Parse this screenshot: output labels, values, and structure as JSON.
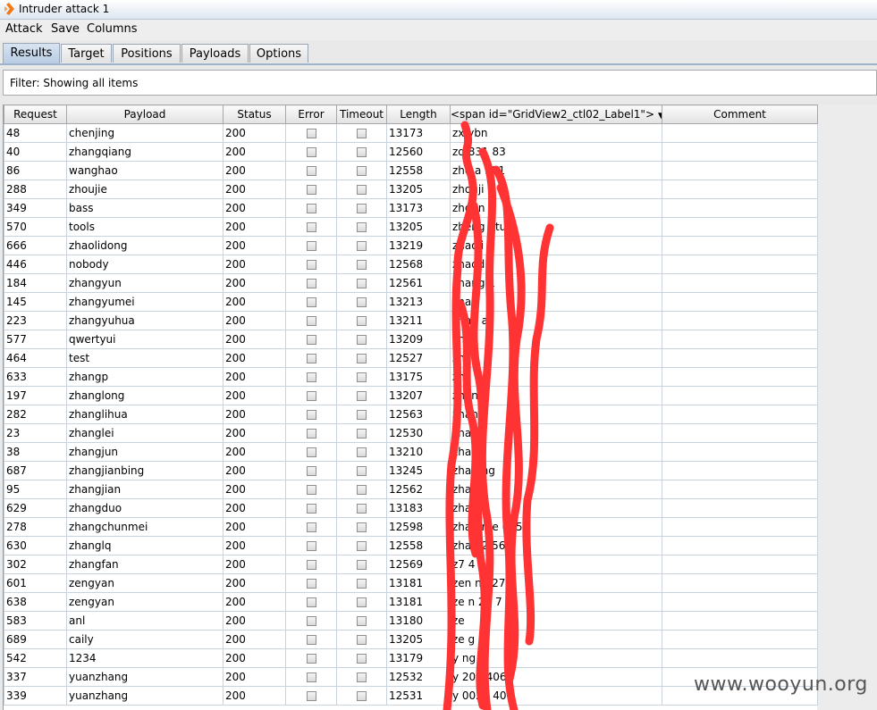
{
  "window": {
    "title": "Intruder attack 1"
  },
  "menu": [
    "Attack",
    "Save",
    "Columns"
  ],
  "tabs": [
    "Results",
    "Target",
    "Positions",
    "Payloads",
    "Options"
  ],
  "active_tab": "Results",
  "filter": {
    "text": "Filter: Showing all items"
  },
  "table": {
    "columns": [
      "Request",
      "Payload",
      "Status",
      "Error",
      "Timeout",
      "Length",
      "<span id=\"GridView2_ctl02_Label1\">",
      "Comment"
    ],
    "rows": [
      {
        "request": "48",
        "payload": "chenjing",
        "status": "200",
        "length": "13173",
        "label": "zx  ybn"
      },
      {
        "request": "40",
        "payload": "zhangqiang",
        "status": "200",
        "length": "12560",
        "label": "zq   831  83"
      },
      {
        "request": "86",
        "payload": "wanghao",
        "status": "200",
        "length": "12558",
        "label": "zho   a    321"
      },
      {
        "request": "288",
        "payload": "zhoujie",
        "status": "200",
        "length": "13205",
        "label": "zhouji"
      },
      {
        "request": "349",
        "payload": "bass",
        "status": "200",
        "length": "13173",
        "label": "zhdon"
      },
      {
        "request": "570",
        "payload": "tools",
        "status": "200",
        "length": "13205",
        "label": "zheng      gtun"
      },
      {
        "request": "666",
        "payload": "zhaolidong",
        "status": "200",
        "length": "13219",
        "label": "zhaoli     g"
      },
      {
        "request": "446",
        "payload": "nobody",
        "status": "200",
        "length": "12568",
        "label": "zhaod"
      },
      {
        "request": "184",
        "payload": "zhangyun",
        "status": "200",
        "length": "12561",
        "label": "zhang     1"
      },
      {
        "request": "145",
        "payload": "zhangyumei",
        "status": "200",
        "length": "13213",
        "label": "zhan"
      },
      {
        "request": "223",
        "payload": "zhangyuhua",
        "status": "200",
        "length": "13211",
        "label": "zhan       a"
      },
      {
        "request": "577",
        "payload": "qwertyui",
        "status": "200",
        "length": "13209",
        "label": "zha"
      },
      {
        "request": "464",
        "payload": "test",
        "status": "200",
        "length": "12527",
        "label": "zhan"
      },
      {
        "request": "633",
        "payload": "zhangp",
        "status": "200",
        "length": "13175",
        "label": "zh"
      },
      {
        "request": "197",
        "payload": "zhanglong",
        "status": "200",
        "length": "13207",
        "label": "zhan"
      },
      {
        "request": "282",
        "payload": "zhanglihua",
        "status": "200",
        "length": "12563",
        "label": "zhan       a"
      },
      {
        "request": "23",
        "payload": "zhanglei",
        "status": "200",
        "length": "12530",
        "label": "zhan"
      },
      {
        "request": "38",
        "payload": "zhangjun",
        "status": "200",
        "length": "13210",
        "label": "zhan"
      },
      {
        "request": "687",
        "payload": "zhangjianbing",
        "status": "200",
        "length": "13245",
        "label": "zhan        ng"
      },
      {
        "request": "95",
        "payload": "zhangjian",
        "status": "200",
        "length": "12562",
        "label": "zhan"
      },
      {
        "request": "629",
        "payload": "zhangduo",
        "status": "200",
        "length": "13183",
        "label": "zhan"
      },
      {
        "request": "278",
        "payload": "zhangchunmei",
        "status": "200",
        "length": "12598",
        "label": "zhan       me  005"
      },
      {
        "request": "630",
        "payload": "zhanglq",
        "status": "200",
        "length": "12558",
        "label": "zhan    2  56"
      },
      {
        "request": "302",
        "payload": "zhangfan",
        "status": "200",
        "length": "12569",
        "label": "z7     4"
      },
      {
        "request": "601",
        "payload": "zengyan",
        "status": "200",
        "length": "13181",
        "label": "zen     n4   27  7"
      },
      {
        "request": "638",
        "payload": "zengyan",
        "status": "200",
        "length": "13181",
        "label": "ze       n    27  7"
      },
      {
        "request": "583",
        "payload": "anl",
        "status": "200",
        "length": "13180",
        "label": "ze"
      },
      {
        "request": "689",
        "payload": "caily",
        "status": "200",
        "length": "13205",
        "label": "ze       g"
      },
      {
        "request": "542",
        "payload": "1234",
        "status": "200",
        "length": "13179",
        "label": "y       ng"
      },
      {
        "request": "337",
        "payload": "yuanzhang",
        "status": "200",
        "length": "12532",
        "label": "y    200   406"
      },
      {
        "request": "339",
        "payload": "yuanzhang",
        "status": "200",
        "length": "12531",
        "label": "y   0020  406"
      }
    ]
  },
  "watermark": "www.wooyun.org",
  "colors": {
    "scribble": "#ff3333",
    "tab_active": "#b7cbe3"
  }
}
